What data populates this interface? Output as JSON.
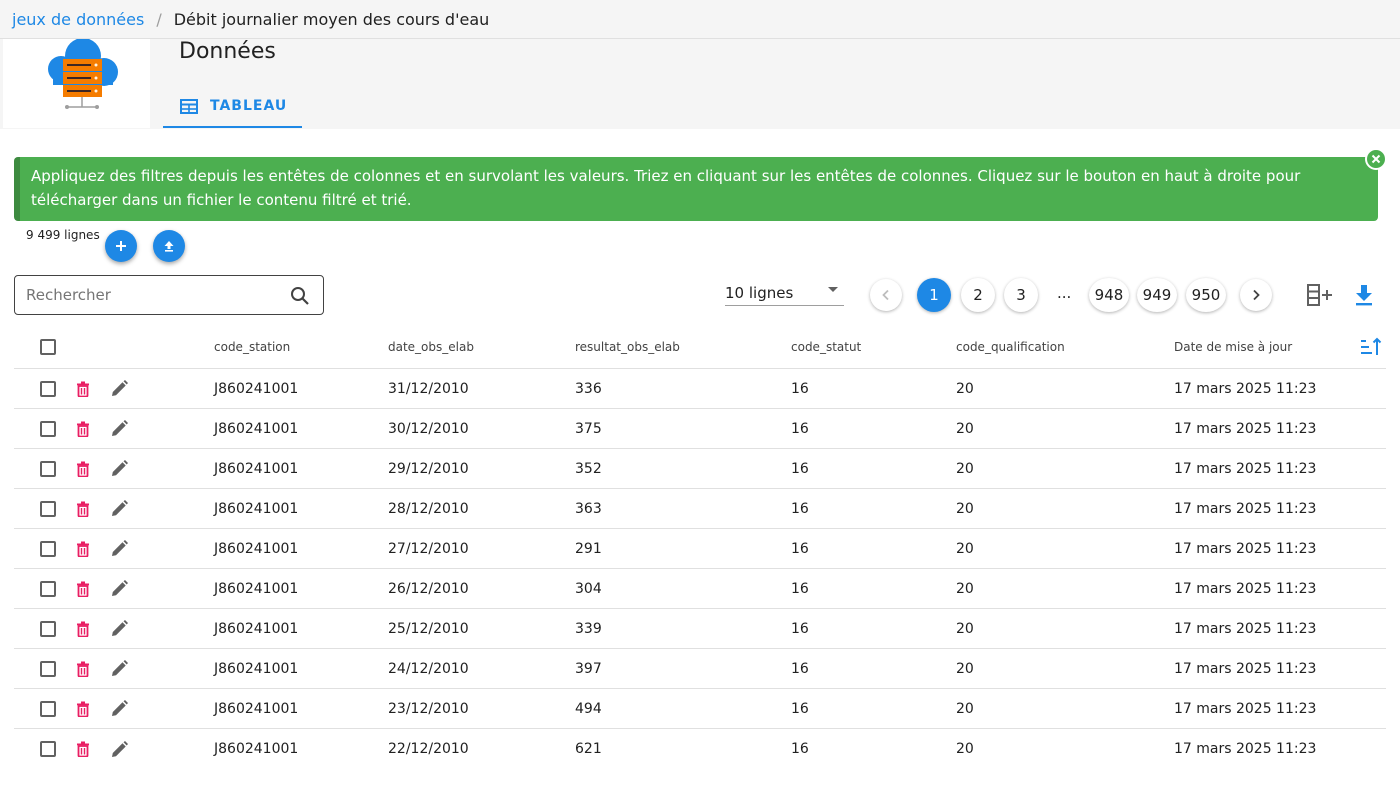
{
  "breadcrumb": {
    "link": "jeux de données",
    "separator": "/",
    "current": "Débit journalier moyen des cours d'eau"
  },
  "header": {
    "title": "Données",
    "tab_label": "TABLEAU"
  },
  "alert": {
    "text": "Appliquez des filtres depuis les entêtes de colonnes et en survolant les valeurs. Triez en cliquant sur les entêtes de colonnes. Cliquez sur le bouton en haut à droite pour télécharger dans un fichier le contenu filtré et trié.",
    "color": "#4caf50"
  },
  "row_count": "9 499 lignes",
  "search": {
    "placeholder": "Rechercher"
  },
  "rows_per_page": "10 lignes",
  "pagination": {
    "pages": [
      "1",
      "2",
      "3",
      "948",
      "949",
      "950"
    ],
    "ellipsis": "...",
    "current": "1"
  },
  "table": {
    "columns": [
      "code_station",
      "date_obs_elab",
      "resultat_obs_elab",
      "code_statut",
      "code_qualification",
      "Date de mise à jour"
    ],
    "rows": [
      [
        "J860241001",
        "31/12/2010",
        "336",
        "16",
        "20",
        "17 mars 2025 11:23"
      ],
      [
        "J860241001",
        "30/12/2010",
        "375",
        "16",
        "20",
        "17 mars 2025 11:23"
      ],
      [
        "J860241001",
        "29/12/2010",
        "352",
        "16",
        "20",
        "17 mars 2025 11:23"
      ],
      [
        "J860241001",
        "28/12/2010",
        "363",
        "16",
        "20",
        "17 mars 2025 11:23"
      ],
      [
        "J860241001",
        "27/12/2010",
        "291",
        "16",
        "20",
        "17 mars 2025 11:23"
      ],
      [
        "J860241001",
        "26/12/2010",
        "304",
        "16",
        "20",
        "17 mars 2025 11:23"
      ],
      [
        "J860241001",
        "25/12/2010",
        "339",
        "16",
        "20",
        "17 mars 2025 11:23"
      ],
      [
        "J860241001",
        "24/12/2010",
        "397",
        "16",
        "20",
        "17 mars 2025 11:23"
      ],
      [
        "J860241001",
        "23/12/2010",
        "494",
        "16",
        "20",
        "17 mars 2025 11:23"
      ],
      [
        "J860241001",
        "22/12/2010",
        "621",
        "16",
        "20",
        "17 mars 2025 11:23"
      ]
    ]
  },
  "colors": {
    "accent": "#1e88e5",
    "delete": "#e91e63",
    "success": "#4caf50"
  },
  "icons": [
    "dataset-logo-icon",
    "table-icon",
    "close-icon",
    "plus-icon",
    "upload-icon",
    "search-icon",
    "chevron-left-icon",
    "chevron-right-icon",
    "add-column-icon",
    "download-icon",
    "sort-icon",
    "delete-icon",
    "edit-icon"
  ]
}
